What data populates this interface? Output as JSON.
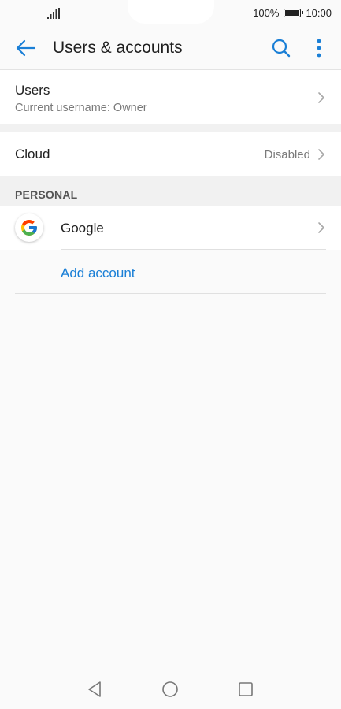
{
  "status_bar": {
    "battery_percent": "100%",
    "time": "10:00"
  },
  "app_bar": {
    "title": "Users & accounts"
  },
  "users_row": {
    "title": "Users",
    "subtitle": "Current username: Owner"
  },
  "cloud_row": {
    "title": "Cloud",
    "value": "Disabled"
  },
  "personal_section": {
    "header": "PERSONAL",
    "accounts": [
      {
        "label": "Google",
        "icon": "google-icon"
      }
    ],
    "add_account_label": "Add account"
  },
  "icons": {
    "back": "arrow-left-icon",
    "search": "search-icon",
    "more": "more-vertical-icon",
    "chevron": "chevron-right-icon",
    "nav_back": "triangle-back-icon",
    "nav_home": "circle-home-icon",
    "nav_recent": "square-recent-icon"
  },
  "colors": {
    "accent": "#1a7fd6",
    "background": "#fafafa",
    "section_bg": "#f1f1f1",
    "secondary_text": "#7a7a7a"
  }
}
